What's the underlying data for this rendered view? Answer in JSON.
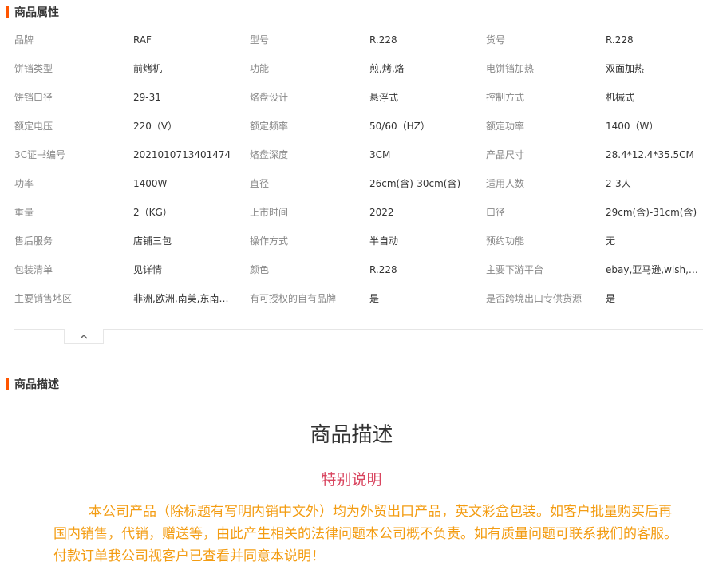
{
  "attributes_section": {
    "title": "商品属性",
    "rows": [
      [
        {
          "label": "品牌",
          "value": "RAF"
        },
        {
          "label": "型号",
          "value": "R.228"
        },
        {
          "label": "货号",
          "value": "R.228"
        }
      ],
      [
        {
          "label": "饼铛类型",
          "value": "前烤机"
        },
        {
          "label": "功能",
          "value": "煎,烤,烙"
        },
        {
          "label": "电饼铛加热",
          "value": "双面加热"
        }
      ],
      [
        {
          "label": "饼铛口径",
          "value": "29-31"
        },
        {
          "label": "烙盘设计",
          "value": "悬浮式"
        },
        {
          "label": "控制方式",
          "value": "机械式"
        }
      ],
      [
        {
          "label": "额定电压",
          "value": "220（V）"
        },
        {
          "label": "额定频率",
          "value": "50/60（HZ）"
        },
        {
          "label": "额定功率",
          "value": "1400（W）"
        }
      ],
      [
        {
          "label": "3C证书编号",
          "value": "2021010713401474"
        },
        {
          "label": "烙盘深度",
          "value": "3CM"
        },
        {
          "label": "产品尺寸",
          "value": "28.4*12.4*35.5CM"
        }
      ],
      [
        {
          "label": "功率",
          "value": "1400W"
        },
        {
          "label": "直径",
          "value": "26cm(含)-30cm(含)"
        },
        {
          "label": "适用人数",
          "value": "2-3人"
        }
      ],
      [
        {
          "label": "重量",
          "value": "2（KG）"
        },
        {
          "label": "上市时间",
          "value": "2022"
        },
        {
          "label": "口径",
          "value": "29cm(含)-31cm(含)"
        }
      ],
      [
        {
          "label": "售后服务",
          "value": "店铺三包"
        },
        {
          "label": "操作方式",
          "value": "半自动"
        },
        {
          "label": "预约功能",
          "value": "无"
        }
      ],
      [
        {
          "label": "包装清单",
          "value": "见详情"
        },
        {
          "label": "颜色",
          "value": "R.228"
        },
        {
          "label": "主要下游平台",
          "value": "ebay,亚马逊,wish,速卖通,独立站,LAZADA"
        }
      ],
      [
        {
          "label": "主要销售地区",
          "value": "非洲,欧洲,南美,东南亚,北美,东北亚,中东"
        },
        {
          "label": "有可授权的自有品牌",
          "value": "是"
        },
        {
          "label": "是否跨境出口专供货源",
          "value": "是"
        }
      ]
    ]
  },
  "description_section": {
    "title": "商品描述",
    "heading": "商品描述",
    "subheading": "特别说明",
    "notice": "本公司产品（除标题有写明内销中文外）均为外贸出口产品，英文彩盒包装。如客户批量购买后再国内销售，代销，赠送等，由此产生相关的法律问题本公司概不负责。如有质量问题可联系我们的客服。付款订单我公司视客户已查看并同意本说明！"
  },
  "colors": {
    "accent": "#ff5500",
    "label": "#888888",
    "subheading": "#d9455f",
    "notice": "#f39c12"
  },
  "icons": {
    "collapse": "chevron-up-icon"
  }
}
